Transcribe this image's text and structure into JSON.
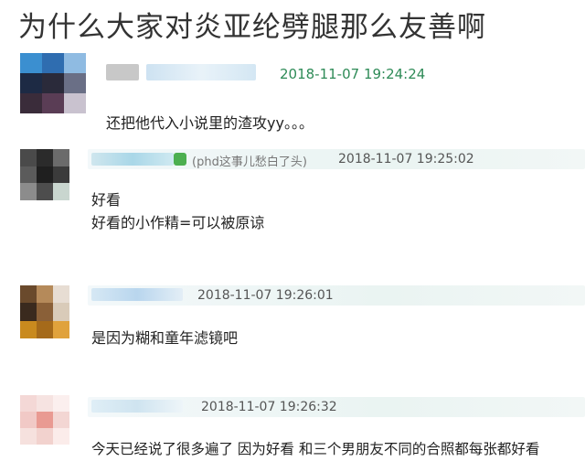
{
  "page_title": "为什么大家对炎亚纶劈腿那么友善啊",
  "posts": [
    {
      "timestamp": "2018-11-07 19:24:24",
      "timestamp_color": "#2e8b57",
      "lines": [
        "还把他代入小说里的渣攻yy。。。"
      ]
    },
    {
      "note": "(phd这事儿愁白了头)",
      "timestamp": "2018-11-07 19:25:02",
      "lines": [
        "好看",
        "好看的小作精=可以被原谅"
      ]
    },
    {
      "timestamp": "2018-11-07 19:26:01",
      "lines": [
        "是因为糊和童年滤镜吧"
      ]
    },
    {
      "timestamp": "2018-11-07 19:26:32",
      "lines": [
        "今天已经说了很多遍了 因为好看 和三个男朋友不同的合照都每张都好看"
      ]
    }
  ]
}
